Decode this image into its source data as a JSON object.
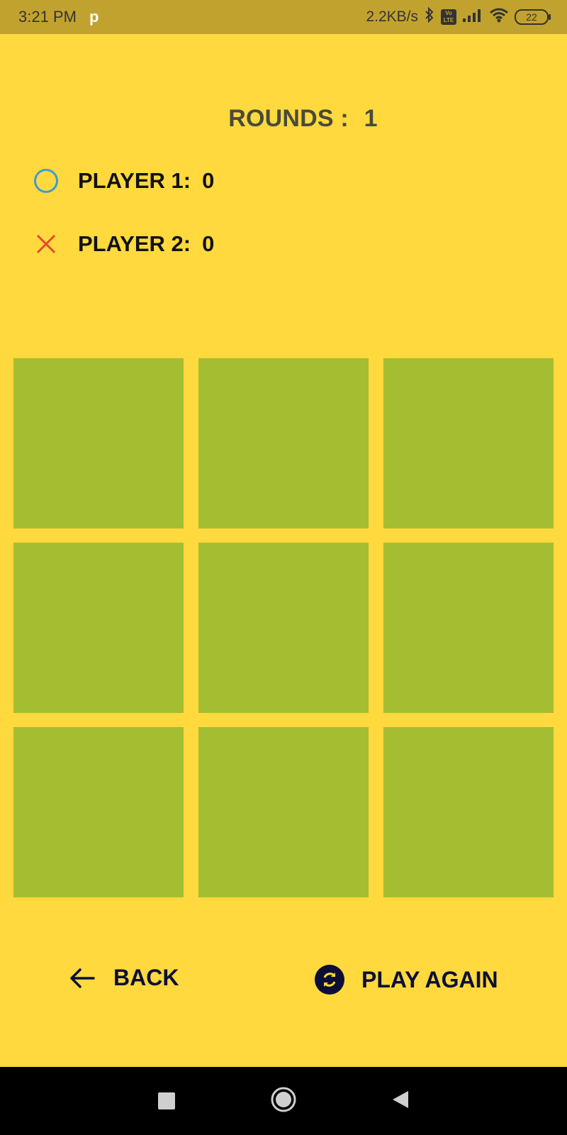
{
  "status_bar": {
    "time": "3:21 PM",
    "app_indicator": "p",
    "network_speed": "2.2KB/s",
    "volte": "Vo\nLTE",
    "battery": "22",
    "icons": [
      "bluetooth-icon",
      "volte-icon",
      "signal-icon",
      "wifi-icon",
      "battery-icon"
    ]
  },
  "game": {
    "rounds_label": "ROUNDS :",
    "rounds_value": "1",
    "players": [
      {
        "label": "PLAYER 1:",
        "score": "0",
        "mark": "circle",
        "color": "#3E9BD5"
      },
      {
        "label": "PLAYER 2:",
        "score": "0",
        "mark": "cross",
        "color": "#E8472F"
      }
    ],
    "board_cells": [
      "",
      "",
      "",
      "",
      "",
      "",
      "",
      "",
      ""
    ]
  },
  "actions": {
    "back_label": "BACK",
    "play_again_label": "PLAY AGAIN"
  },
  "colors": {
    "background": "#FFD93D",
    "status_bar": "#C2A22E",
    "cell": "#A5BE31",
    "button_text": "#0B0F36"
  },
  "nav_bar": {
    "icons": [
      "recent-apps-icon",
      "home-icon",
      "back-nav-icon"
    ]
  }
}
